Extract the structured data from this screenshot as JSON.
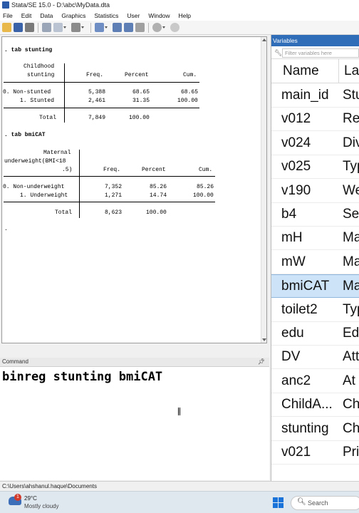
{
  "window": {
    "title": "Stata/SE 15.0 - D:\\abc\\MyData.dta"
  },
  "menu": [
    "File",
    "Edit",
    "Data",
    "Graphics",
    "Statistics",
    "User",
    "Window",
    "Help"
  ],
  "results": {
    "tab1": {
      "command": ". tab stunting",
      "header_line1": "Childhood",
      "header_line2": "stunting",
      "col_freq": "Freq.",
      "col_percent": "Percent",
      "col_cum": "Cum.",
      "rows": [
        {
          "label": "0. Non-stunted",
          "freq": "5,388",
          "percent": "68.65",
          "cum": "68.65"
        },
        {
          "label": "1. Stunted",
          "freq": "2,461",
          "percent": "31.35",
          "cum": "100.00"
        }
      ],
      "total_label": "Total",
      "total_freq": "7,849",
      "total_percent": "100.00"
    },
    "tab2": {
      "command": ". tab bmiCAT",
      "header_line1": "Maternal",
      "header_line2": "underweight(BMI<18",
      "header_line3": ".5)",
      "col_freq": "Freq.",
      "col_percent": "Percent",
      "col_cum": "Cum.",
      "rows": [
        {
          "label": "0. Non-underweight",
          "freq": "7,352",
          "percent": "85.26",
          "cum": "85.26"
        },
        {
          "label": "1. Underweight",
          "freq": "1,271",
          "percent": "14.74",
          "cum": "100.00"
        }
      ],
      "total_label": "Total",
      "total_freq": "8,623",
      "total_percent": "100.00"
    },
    "prompt": "."
  },
  "command_window": {
    "header": "Command",
    "text": "binreg stunting bmiCAT"
  },
  "variables": {
    "header": "Variables",
    "filter_placeholder": "Filter variables here",
    "col_name": "Name",
    "col_label": "La",
    "rows": [
      {
        "name": "main_id",
        "label": "Stu"
      },
      {
        "name": "v012",
        "label": "Re"
      },
      {
        "name": "v024",
        "label": "Div"
      },
      {
        "name": "v025",
        "label": "Typ"
      },
      {
        "name": "v190",
        "label": "We"
      },
      {
        "name": "b4",
        "label": "Sex"
      },
      {
        "name": "mH",
        "label": "Ma"
      },
      {
        "name": "mW",
        "label": "Ma"
      },
      {
        "name": "bmiCAT",
        "label": "Ma",
        "selected": true
      },
      {
        "name": "toilet2",
        "label": "Typ"
      },
      {
        "name": "edu",
        "label": "Ed"
      },
      {
        "name": "DV",
        "label": "Att"
      },
      {
        "name": "anc2",
        "label": "At l"
      },
      {
        "name": "ChildA...",
        "label": "Ch"
      },
      {
        "name": "stunting",
        "label": "Ch"
      },
      {
        "name": "v021",
        "label": "Pri"
      }
    ]
  },
  "status_bar": {
    "path": "C:\\Users\\ahshanul.haque\\Documents"
  },
  "taskbar": {
    "weather_badge": "1",
    "temperature": "29°C",
    "condition": "Mostly cloudy",
    "search_label": "Search"
  },
  "colors": {
    "accent": "#2f6db8",
    "selection": "#cde3f7"
  }
}
